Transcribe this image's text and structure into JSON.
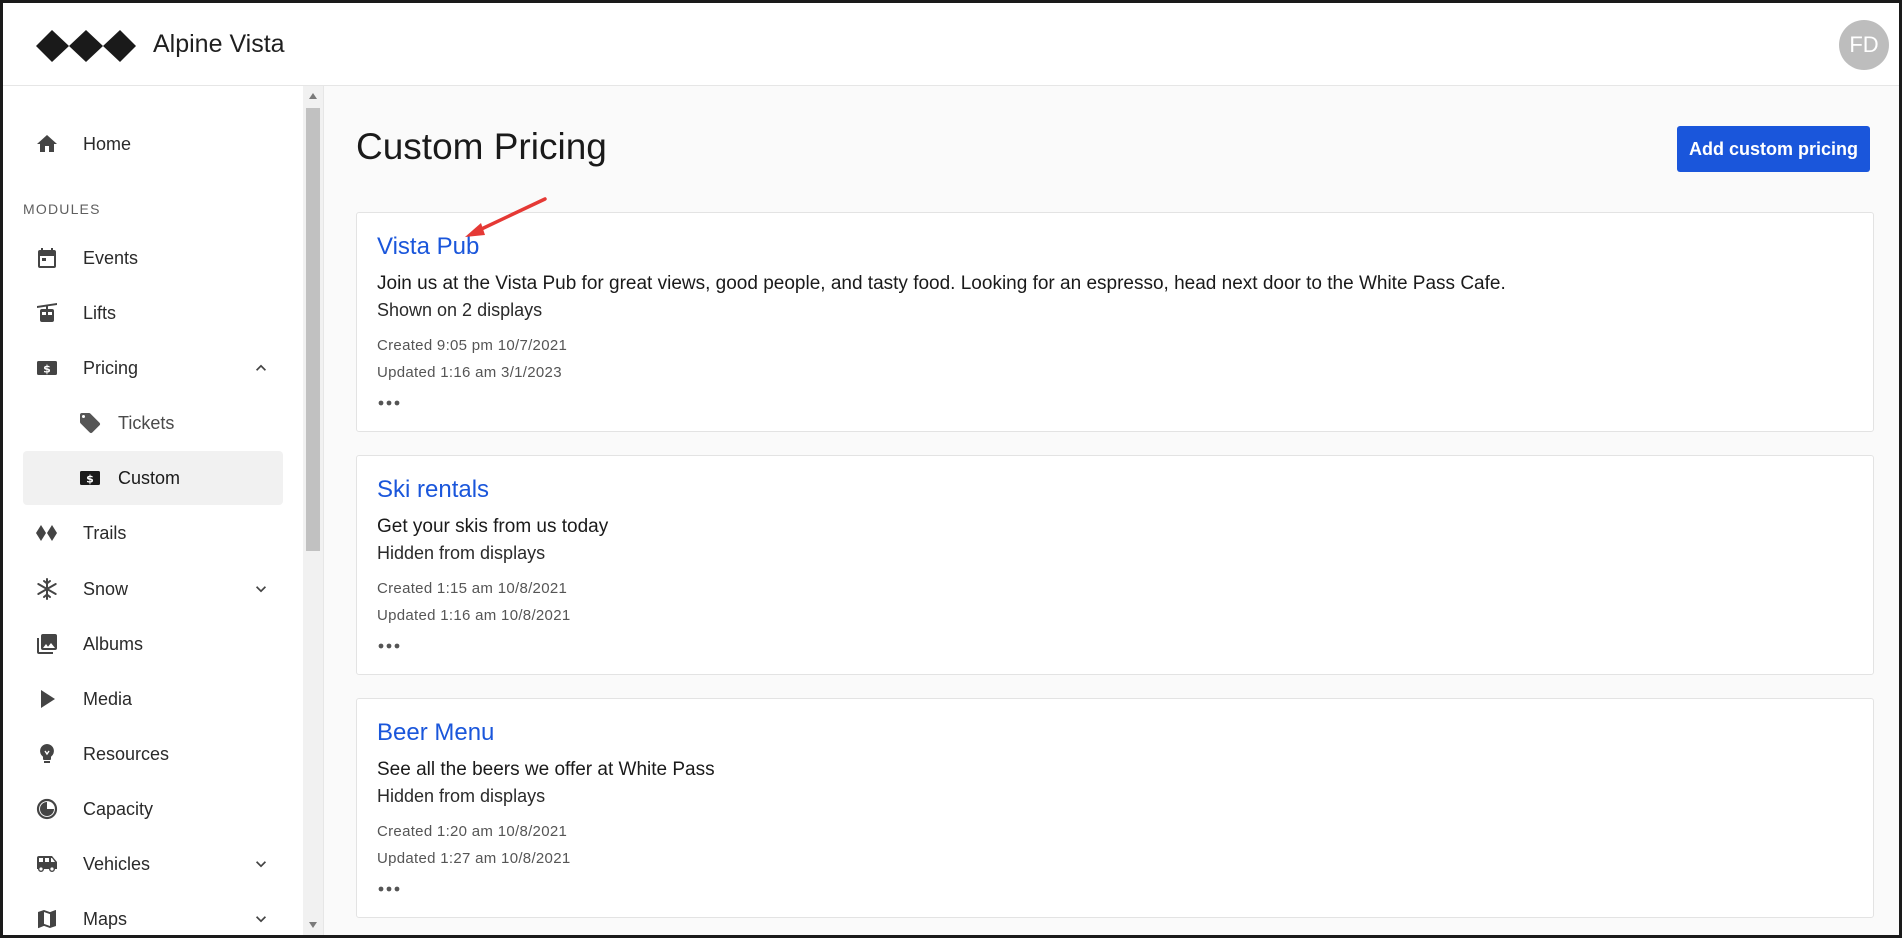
{
  "header": {
    "app_title": "Alpine Vista",
    "avatar_initials": "FD"
  },
  "sidebar": {
    "home_label": "Home",
    "section_label": "MODULES",
    "items": [
      {
        "label": "Events",
        "icon": "calendar-icon"
      },
      {
        "label": "Lifts",
        "icon": "gondola-icon"
      },
      {
        "label": "Pricing",
        "icon": "dollar-icon",
        "expanded": true
      },
      {
        "label": "Tickets",
        "icon": "tag-icon"
      },
      {
        "label": "Custom",
        "icon": "dollar-icon",
        "active": true
      },
      {
        "label": "Trails",
        "icon": "trails-icon"
      },
      {
        "label": "Snow",
        "icon": "snowflake-icon",
        "expanded": false
      },
      {
        "label": "Albums",
        "icon": "photo-library-icon"
      },
      {
        "label": "Media",
        "icon": "play-icon"
      },
      {
        "label": "Resources",
        "icon": "lightbulb-icon"
      },
      {
        "label": "Capacity",
        "icon": "gauge-icon"
      },
      {
        "label": "Vehicles",
        "icon": "bus-icon",
        "expanded": false
      },
      {
        "label": "Maps",
        "icon": "map-icon",
        "expanded": false
      }
    ]
  },
  "main": {
    "page_title": "Custom Pricing",
    "add_button_label": "Add custom pricing",
    "cards": [
      {
        "title": "Vista Pub",
        "description": "Join us at the Vista Pub for great views, good people, and tasty food. Looking for an espresso, head next door to the White Pass Cafe.",
        "status": "Shown on 2 displays",
        "created": "Created 9:05 pm 10/7/2021",
        "updated": "Updated 1:16 am 3/1/2023"
      },
      {
        "title": "Ski rentals",
        "description": "Get your skis from us today",
        "status": "Hidden from displays",
        "created": "Created 1:15 am 10/8/2021",
        "updated": "Updated 1:16 am 10/8/2021"
      },
      {
        "title": "Beer Menu",
        "description": "See all the beers we offer at White Pass",
        "status": "Hidden from displays",
        "created": "Created 1:20 am 10/8/2021",
        "updated": "Updated 1:27 am 10/8/2021"
      }
    ]
  },
  "colors": {
    "accent": "#1a56db",
    "annotation": "#e53935",
    "active_nav": "#f1f1f1"
  }
}
